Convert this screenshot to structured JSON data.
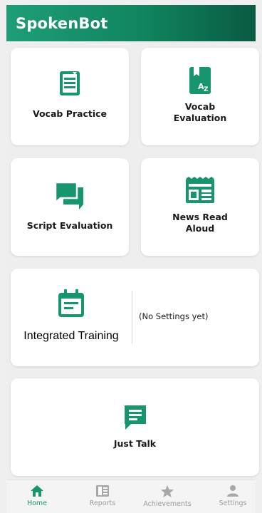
{
  "app": {
    "title": "SpokenBot"
  },
  "colors": {
    "accent": "#17956f",
    "inactive": "#a8a8a8"
  },
  "cards": {
    "vocab_practice": {
      "label": "Vocab Practice",
      "icon": "list-icon"
    },
    "vocab_evaluation": {
      "label_line1": "Vocab",
      "label_line2": "Evaluation",
      "icon": "book-az-icon"
    },
    "script_evaluation": {
      "label": "Script Evaluation",
      "icon": "chat-bubbles-icon"
    },
    "news_read_aloud": {
      "label_line1": "News Read",
      "label_line2": "Aloud",
      "icon": "newspaper-icon"
    },
    "integrated_training": {
      "label": "Integrated Training",
      "settings_text": "(No Settings yet)",
      "icon": "calendar-icon"
    },
    "just_talk": {
      "label": "Just Talk",
      "icon": "message-icon"
    }
  },
  "nav": {
    "items": [
      {
        "label": "Home",
        "icon": "home-icon",
        "active": true
      },
      {
        "label": "Reports",
        "icon": "reports-icon",
        "active": false
      },
      {
        "label": "Achievements",
        "icon": "star-icon",
        "active": false
      },
      {
        "label": "Settings",
        "icon": "person-icon",
        "active": false
      }
    ]
  }
}
